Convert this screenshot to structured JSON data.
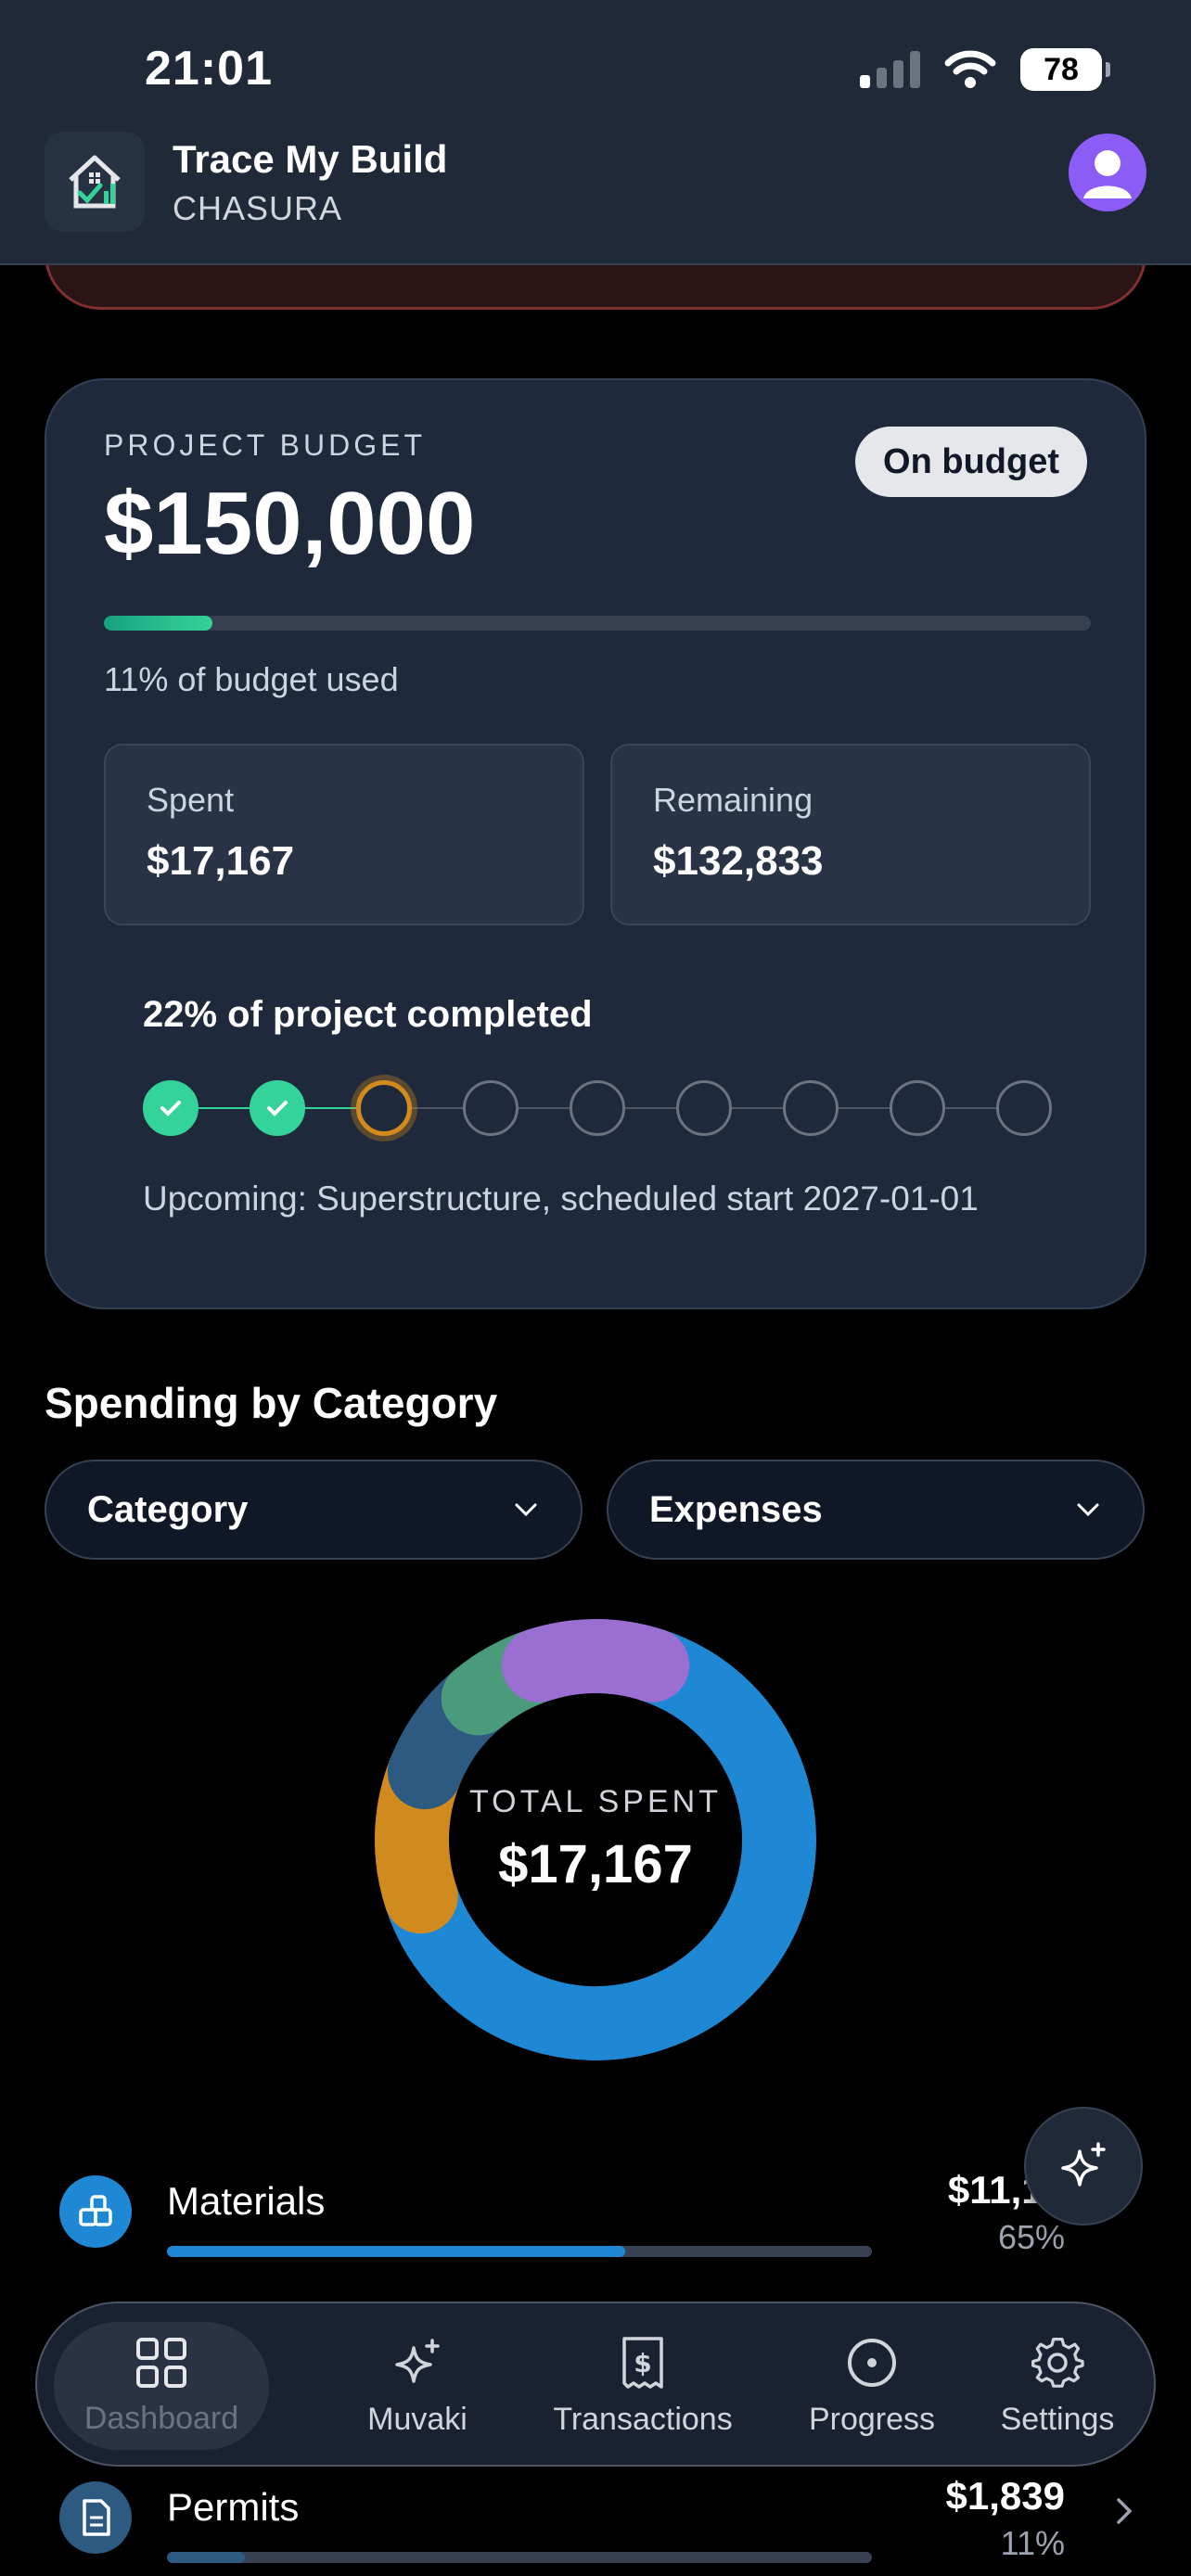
{
  "status_bar": {
    "time": "21:01",
    "battery": "78"
  },
  "header": {
    "title": "Trace My Build",
    "subtitle": "CHASURA"
  },
  "budget": {
    "label": "PROJECT BUDGET",
    "amount": "$150,000",
    "badge": "On budget",
    "used_fraction": 0.11,
    "used_text": "11% of budget used",
    "spent_label": "Spent",
    "spent_value": "$17,167",
    "remaining_label": "Remaining",
    "remaining_value": "$132,833",
    "completed_text": "22% of project completed",
    "stages_total": 9,
    "stages_done": 2,
    "upcoming_text": "Upcoming: Superstructure, scheduled start 2027-01-01"
  },
  "spending": {
    "title": "Spending by Category",
    "group_by": "Category",
    "view": "Expenses",
    "donut_label": "TOTAL SPENT",
    "donut_value": "$17,167",
    "segments": [
      {
        "color": "#1e88d4",
        "fraction": 0.65
      },
      {
        "color": "#d18a1e",
        "fraction": 0.11
      },
      {
        "color": "#2d5a80",
        "fraction": 0.08
      },
      {
        "color": "#4a9a7c",
        "fraction": 0.06
      },
      {
        "color": "#9b6fd1",
        "fraction": 0.1
      }
    ],
    "categories": [
      {
        "name": "Materials",
        "amount": "$11,15",
        "percent": "65%",
        "fraction": 0.65,
        "color": "#1e88d4"
      },
      {
        "name": "Permits",
        "amount": "$1,839",
        "percent": "11%",
        "fraction": 0.11,
        "color": "#2d5a80"
      }
    ]
  },
  "nav": {
    "items": [
      {
        "label": "Dashboard",
        "icon": "grid-icon"
      },
      {
        "label": "Muvaki",
        "icon": "sparkle-icon"
      },
      {
        "label": "Transactions",
        "icon": "receipt-icon"
      },
      {
        "label": "Progress",
        "icon": "target-icon"
      },
      {
        "label": "Settings",
        "icon": "gear-icon"
      }
    ]
  },
  "colors": {
    "accent_green": "#34d399",
    "current_stage": "#d18a1e",
    "avatar": "#8b5cf6"
  }
}
